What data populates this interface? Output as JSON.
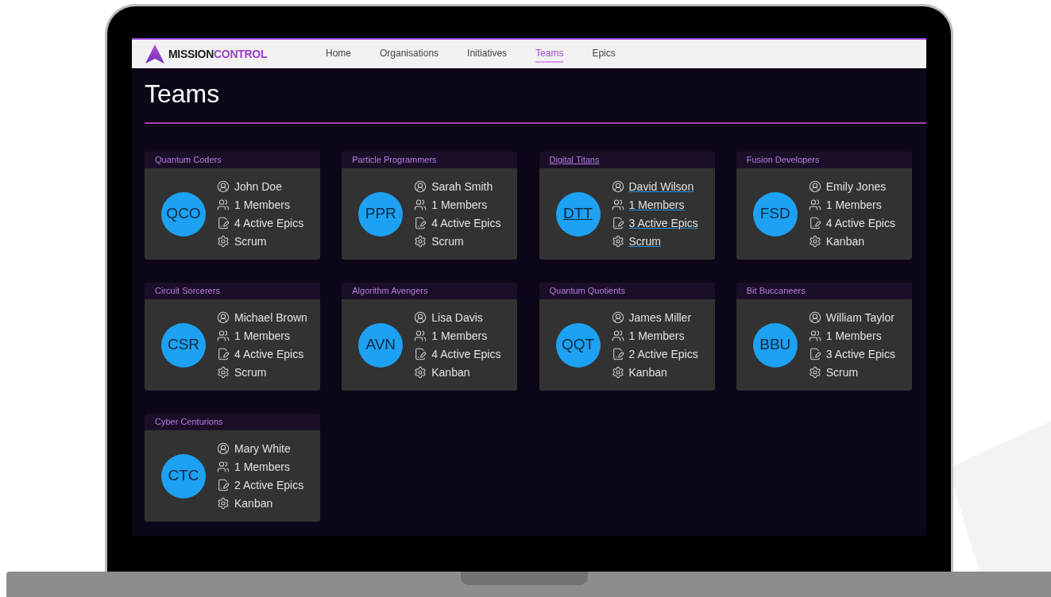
{
  "logo": {
    "first": "MISSION",
    "second": "CONTROL"
  },
  "nav": [
    {
      "label": "Home",
      "selected": false
    },
    {
      "label": "Organisations",
      "selected": false
    },
    {
      "label": "Initiatives",
      "selected": false
    },
    {
      "label": "Teams",
      "selected": true
    },
    {
      "label": "Epics",
      "selected": false
    }
  ],
  "page_title": "Teams",
  "teams": [
    {
      "name": "Quantum Coders",
      "initials": "QCO",
      "lead": "John Doe",
      "members": "1 Members",
      "epics": "4 Active Epics",
      "method": "Scrum",
      "hovered": false
    },
    {
      "name": "Particle Programmers",
      "initials": "PPR",
      "lead": "Sarah Smith",
      "members": "1 Members",
      "epics": "4 Active Epics",
      "method": "Scrum",
      "hovered": false
    },
    {
      "name": "Digital Titans",
      "initials": "DTT",
      "lead": "David Wilson",
      "members": "1 Members",
      "epics": "3 Active Epics",
      "method": "Scrum",
      "hovered": true
    },
    {
      "name": "Fusion Developers",
      "initials": "FSD",
      "lead": "Emily Jones",
      "members": "1 Members",
      "epics": "4 Active Epics",
      "method": "Kanban",
      "hovered": false
    },
    {
      "name": "Circuit Sorcerers",
      "initials": "CSR",
      "lead": "Michael Brown",
      "members": "1 Members",
      "epics": "4 Active Epics",
      "method": "Scrum",
      "hovered": false
    },
    {
      "name": "Algorithm Avengers",
      "initials": "AVN",
      "lead": "Lisa Davis",
      "members": "1 Members",
      "epics": "4 Active Epics",
      "method": "Kanban",
      "hovered": false
    },
    {
      "name": "Quantum Quotients",
      "initials": "QQT",
      "lead": "James Miller",
      "members": "1 Members",
      "epics": "2 Active Epics",
      "method": "Kanban",
      "hovered": false
    },
    {
      "name": "Bit Buccaneers",
      "initials": "BBU",
      "lead": "William Taylor",
      "members": "1 Members",
      "epics": "3 Active Epics",
      "method": "Scrum",
      "hovered": false
    },
    {
      "name": "Cyber Centurions",
      "initials": "CTC",
      "lead": "Mary White",
      "members": "1 Members",
      "epics": "2 Active Epics",
      "method": "Kanban",
      "hovered": false
    }
  ]
}
